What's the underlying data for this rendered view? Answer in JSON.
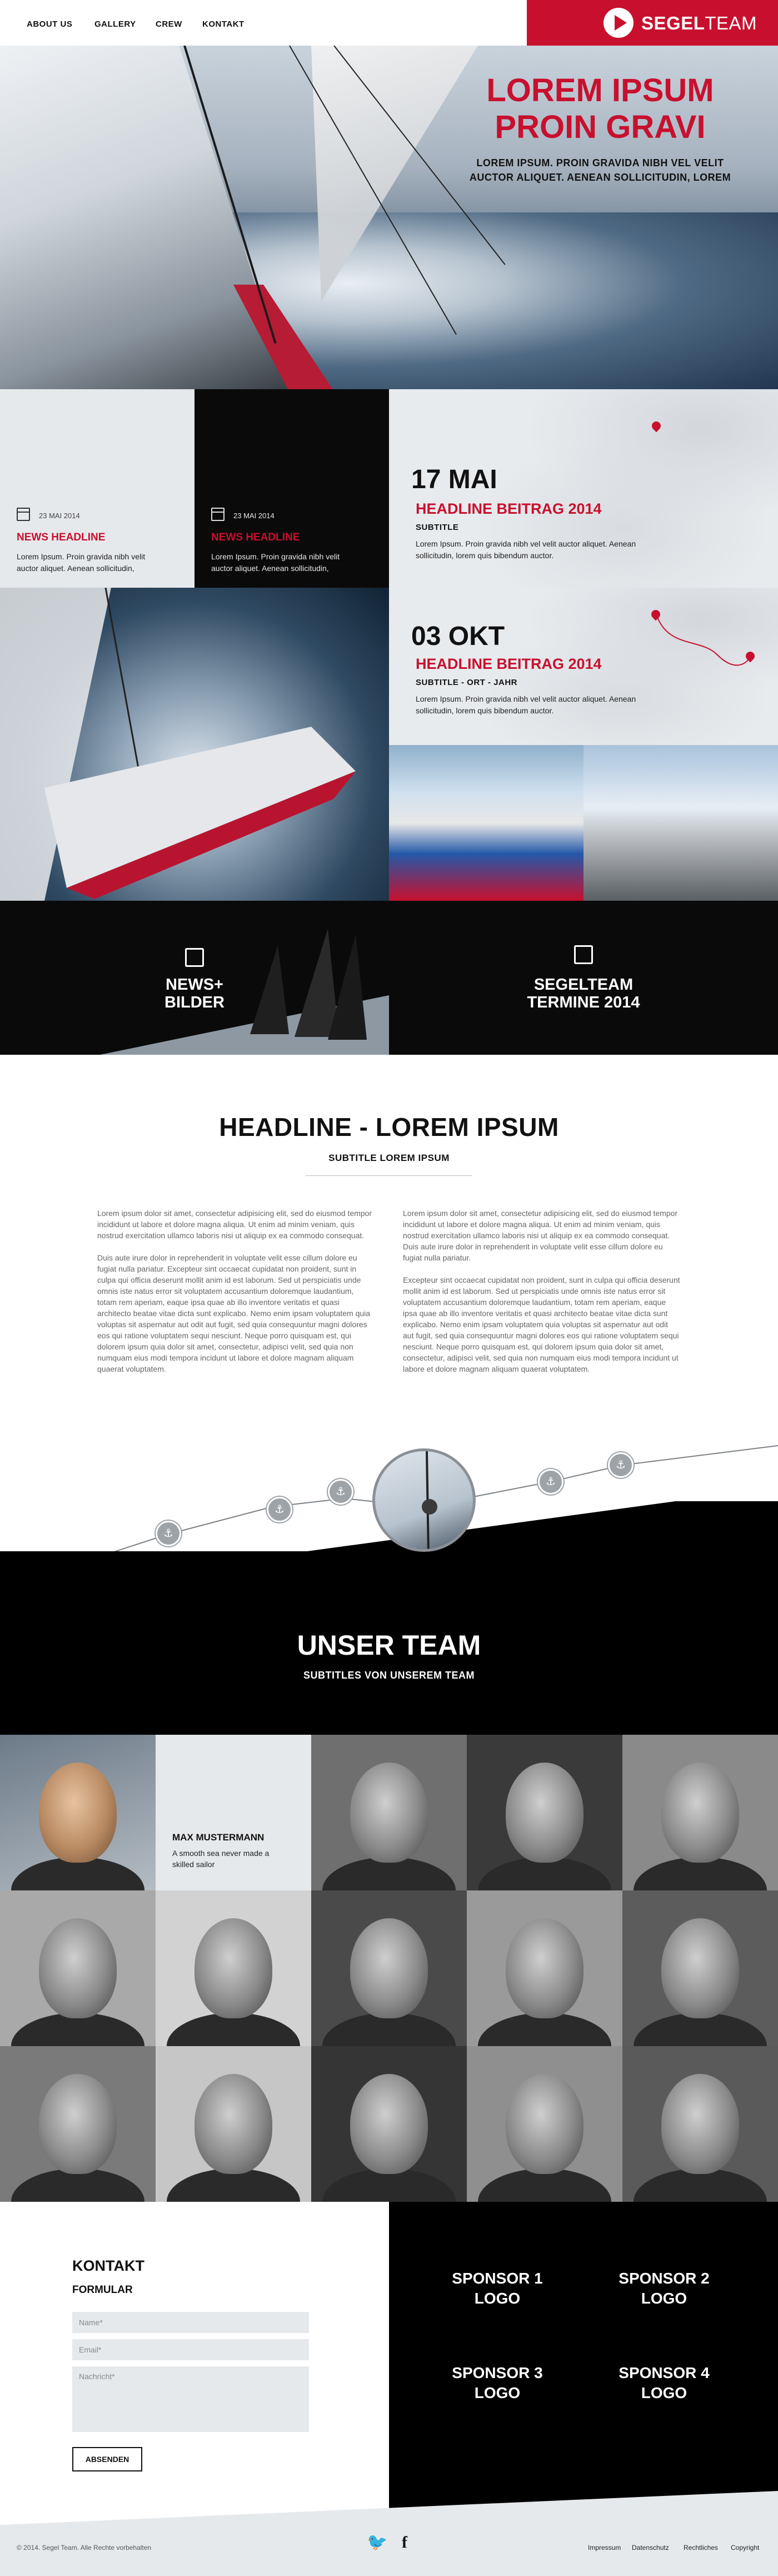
{
  "nav": {
    "items": [
      "ABOUT US",
      "GALLERY",
      "CREW",
      "KONTAKT"
    ],
    "brand_bold": "SEGEL",
    "brand_light": "TEAM",
    "brand_color": "#c8102e"
  },
  "hero": {
    "title_line1": "LOREM IPSUM",
    "title_line2": "PROIN GRAVI",
    "subtitle_line1": "LOREM IPSUM. PROIN GRAVIDA NIBH VEL VELIT",
    "subtitle_line2": "AUCTOR ALIQUET.  AENEAN SOLLICITUDIN, LOREM"
  },
  "news": [
    {
      "date": "23 MAI 2014",
      "headline": "NEWS HEADLINE",
      "text": "Lorem Ipsum. Proin gravida nibh velit auctor aliquet.  Aenean sollicitudin,"
    },
    {
      "date": "23 MAI 2014",
      "headline": "NEWS HEADLINE",
      "text": "Lorem Ipsum. Proin gravida nibh velit auctor aliquet.  Aenean sollicitudin,"
    }
  ],
  "events": [
    {
      "date": "17 MAI",
      "title": "HEADLINE BEITRAG 2014",
      "subtitle": "SUBTITLE",
      "text": "Lorem Ipsum.  Proin gravida nibh vel velit auctor aliquet. Aenean sollicitudin, lorem quis bibendum auctor."
    },
    {
      "date": "03 OKT",
      "title": "HEADLINE BEITRAG 2014",
      "subtitle": "SUBTITLE - ORT - JAHR",
      "text": "Lorem Ipsum.  Proin gravida nibh vel velit auctor aliquet. Aenean sollicitudin, lorem quis bibendum auctor."
    }
  ],
  "cta": {
    "news_line1": "NEWS+",
    "news_line2": "BILDER",
    "termine_line1": "SEGELTEAM",
    "termine_line2": "TERMINE 2014"
  },
  "content": {
    "headline": "HEADLINE - LOREM IPSUM",
    "subheadline": "SUBTITLE LOREM IPSUM",
    "left_p1": "Lorem ipsum dolor sit amet, consectetur adipisicing elit, sed do eiusmod tempor incididunt ut labore et dolore magna aliqua. Ut enim ad minim veniam, quis nostrud exercitation ullamco laboris nisi ut aliquip ex ea commodo consequat.",
    "left_p2": "Duis aute irure dolor in reprehenderit in voluptate velit esse cillum dolore eu fugiat nulla pariatur.  Excepteur sint occaecat cupidatat non proident, sunt in culpa qui officia deserunt mollit anim id est laborum.  Sed ut perspiciatis unde omnis iste natus error sit voluptatem accusantium doloremque laudantium, totam rem aperiam, eaque ipsa quae ab illo inventore veritatis et quasi architecto beatae vitae dicta sunt explicabo. Nemo enim ipsam voluptatem quia voluptas sit aspernatur aut odit aut fugit, sed quia consequuntur magni dolores eos qui ratione voluptatem sequi nesciunt. Neque porro quisquam est, qui dolorem ipsum quia dolor sit amet, consectetur, adipisci velit, sed quia non numquam eius modi tempora incidunt ut labore et dolore magnam aliquam quaerat voluptatem.",
    "right_p1": "Lorem ipsum dolor sit amet, consectetur adipisicing elit, sed do eiusmod tempor incididunt ut labore et dolore magna aliqua. Ut enim ad minim veniam, quis nostrud exercitation ullamco laboris nisi ut aliquip ex ea commodo consequat. Duis aute irure dolor in reprehenderit in voluptate velit esse cillum dolore eu fugiat nulla pariatur.",
    "right_p2": "Excepteur sint occaecat cupidatat non proident, sunt in culpa qui officia deserunt mollit anim id est laborum. Sed ut perspiciatis unde omnis iste natus error sit voluptatem accusantium doloremque laudantium, totam rem aperiam, eaque ipsa quae ab illo inventore veritatis et quasi architecto beatae vitae dicta sunt explicabo. Nemo enim ipsam voluptatem quia voluptas sit aspernatur aut odit aut fugit, sed quia consequuntur magni dolores eos qui ratione voluptatem sequi nesciunt. Neque porro quisquam est, qui dolorem ipsum quia dolor sit amet, consectetur, adipisci velit, sed quia non numquam eius modi tempora incidunt ut labore et dolore magnam aliquam quaerat voluptatem."
  },
  "team": {
    "title": "UNSER TEAM",
    "subtitle": "SUBTITLES VON UNSEREM TEAM",
    "member_name": "MAX MUSTERMANN",
    "member_desc": "A smooth sea never made a skilled sailor"
  },
  "contact": {
    "title": "KONTAKT",
    "subtitle": "FORMULAR",
    "name_placeholder": "Name*",
    "email_placeholder": "Email*",
    "message_placeholder": "Nachricht*",
    "send_label": "ABSENDEN"
  },
  "sponsors": [
    {
      "line1": "SPONSOR 1",
      "line2": "LOGO"
    },
    {
      "line1": "SPONSOR 2",
      "line2": "LOGO"
    },
    {
      "line1": "SPONSOR 3",
      "line2": "LOGO"
    },
    {
      "line1": "SPONSOR 4",
      "line2": "LOGO"
    }
  ],
  "footer": {
    "copyright": "© 2014. Segel Team. Alle Rechte vorbehalten",
    "links": [
      "Impressum",
      "Datenschutz",
      "Rechtliches",
      "Copyright"
    ],
    "social_icons": [
      "twitter-icon",
      "facebook-icon"
    ]
  }
}
